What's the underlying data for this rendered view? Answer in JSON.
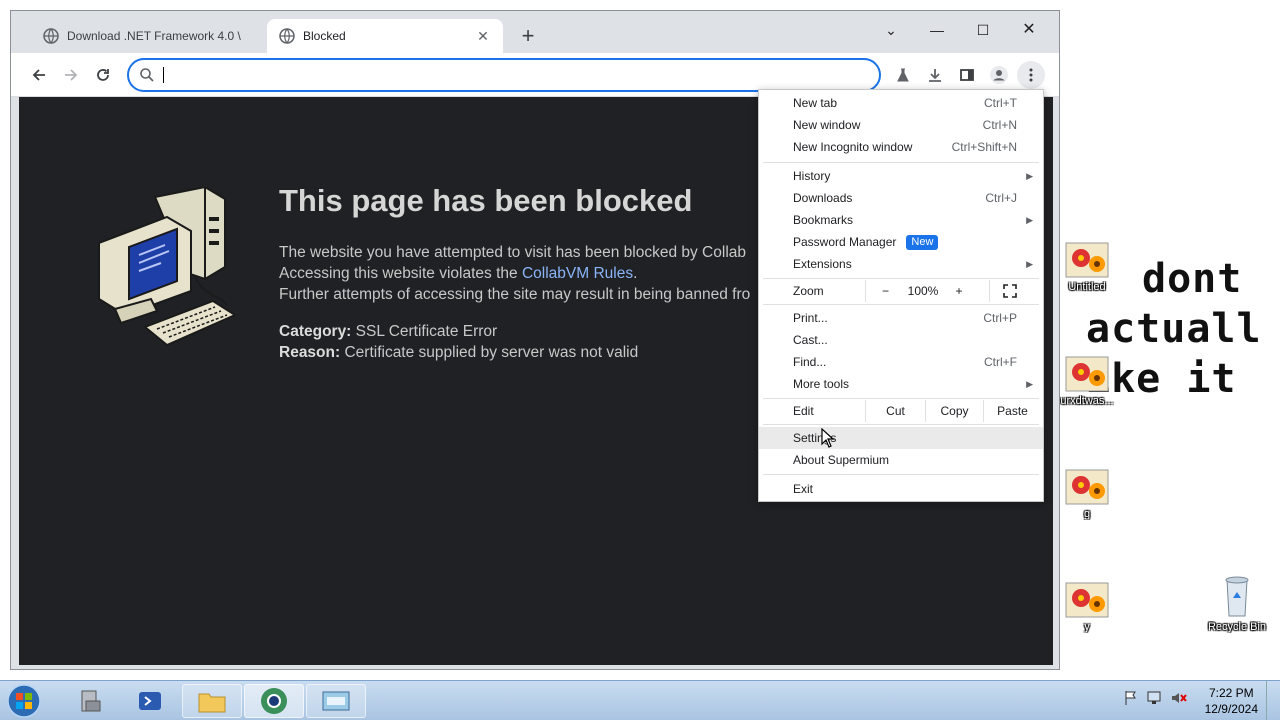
{
  "browser": {
    "tabs": [
      {
        "title": "Download .NET Framework 4.0 \\"
      },
      {
        "title": "Blocked"
      }
    ],
    "omnibox": {
      "value": ""
    }
  },
  "page": {
    "title": "This page has been blocked",
    "line1": "The website you have attempted to visit has been blocked by Collab",
    "line2_pre": "Accessing this website violates the ",
    "line2_link": "CollabVM Rules",
    "line2_post": ".",
    "line3": "Further attempts of accessing the site may result in being banned fro",
    "category_label": "Category:",
    "category_value": " SSL Certificate Error",
    "reason_label": "Reason:",
    "reason_value": " Certificate supplied by server was not valid"
  },
  "menu": {
    "new_tab": "New tab",
    "new_tab_sc": "Ctrl+T",
    "new_window": "New window",
    "new_window_sc": "Ctrl+N",
    "new_incognito": "New Incognito window",
    "new_incognito_sc": "Ctrl+Shift+N",
    "history": "History",
    "downloads": "Downloads",
    "downloads_sc": "Ctrl+J",
    "bookmarks": "Bookmarks",
    "password_manager": "Password Manager",
    "new_badge": "New",
    "extensions": "Extensions",
    "zoom": "Zoom",
    "zoom_minus": "−",
    "zoom_level": "100%",
    "zoom_plus": "+",
    "print": "Print...",
    "print_sc": "Ctrl+P",
    "cast": "Cast...",
    "find": "Find...",
    "find_sc": "Ctrl+F",
    "more_tools": "More tools",
    "edit": "Edit",
    "cut": "Cut",
    "copy": "Copy",
    "paste": "Paste",
    "settings": "Settings",
    "about": "About Supermium",
    "exit": "Exit"
  },
  "desktop": {
    "icons": [
      {
        "label": "Untitled"
      },
      {
        "label": "urxdtwas..."
      },
      {
        "label": "g"
      },
      {
        "label": "y"
      },
      {
        "label": "Recycle Bin"
      }
    ],
    "wallpaper_text": [
      "dont",
      "actuall",
      "ike it"
    ]
  },
  "taskbar": {
    "time": "7:22 PM",
    "date": "12/9/2024"
  },
  "colors": {
    "accent": "#1a73e8",
    "blocked_bg": "#202124",
    "link": "#8ab4f8"
  }
}
